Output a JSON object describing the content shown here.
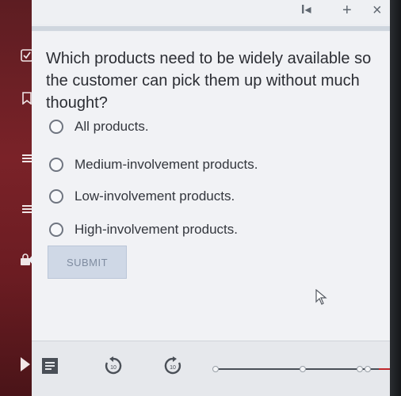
{
  "window": {
    "controls": {
      "first": "I◂",
      "add": "+",
      "close": "×"
    }
  },
  "quiz": {
    "question": "Which products need to be widely available so the customer can pick them up without much thought?",
    "options": [
      "All products.",
      "Medium-involvement products.",
      "Low-involvement products.",
      "High-involvement products."
    ],
    "submit_label": "SUBMIT"
  },
  "toolbar": {
    "replay_back_label": "10",
    "forward_label": "10"
  },
  "colors": {
    "sidebar": "#7a2228",
    "submit_bg": "#cfd8e6",
    "progress_accent": "#c0262b"
  }
}
